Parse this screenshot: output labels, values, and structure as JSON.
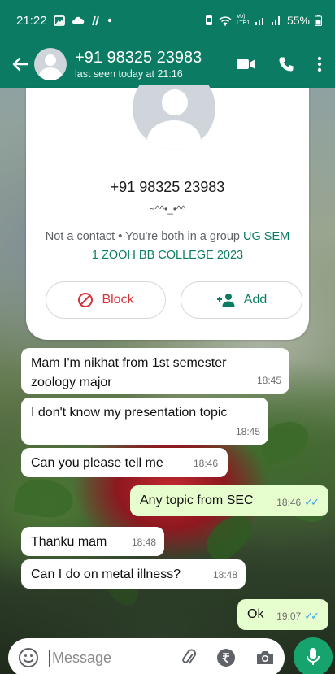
{
  "status_bar": {
    "time": "21:22",
    "battery": "55%",
    "network": "Vo) LTE1"
  },
  "app_bar": {
    "title": "+91 98325 23983",
    "subtitle": "last seen today at 21:16"
  },
  "contact_card": {
    "phone": "+91 98325 23983",
    "about": "~^^•_•^^",
    "group_prefix": "Not a contact • You're both in a group ",
    "group_name": "UG SEM 1 ZOOH BB COLLEGE 2023",
    "block_label": "Block",
    "add_label": "Add"
  },
  "messages": [
    {
      "direction": "in",
      "text": "Mam I'm nikhat from 1st semester zoology major",
      "time": "18:45"
    },
    {
      "direction": "in",
      "text": "I don't know my presentation topic",
      "time": "18:45"
    },
    {
      "direction": "in",
      "text": "Can you please tell me",
      "time": "18:46"
    },
    {
      "direction": "out",
      "text": "Any topic from SEC",
      "time": "18:46",
      "read": true
    },
    {
      "direction": "in",
      "text": "Thanku mam",
      "time": "18:48"
    },
    {
      "direction": "in",
      "text": "Can I do on metal illness?",
      "time": "18:48"
    },
    {
      "direction": "out",
      "text": "Ok",
      "time": "19:07",
      "read": true
    }
  ],
  "input": {
    "placeholder": "Message"
  },
  "colors": {
    "header": "#0b7c63",
    "outgoing_bubble": "#e6fdcd",
    "incoming_bubble": "#ffffff",
    "block": "#d6333a",
    "mic": "#16a36e",
    "read_ticks": "#3aa6e8"
  },
  "icons": {
    "status": [
      "gallery-icon",
      "cloud-icon",
      "nfc-icon",
      "dot-icon",
      "vibrate-icon",
      "wifi-icon",
      "signal-icon",
      "battery-icon"
    ],
    "header": [
      "back-arrow-icon",
      "video-call-icon",
      "voice-call-icon",
      "more-options-icon"
    ],
    "input": [
      "emoji-icon",
      "attach-icon",
      "rupee-payment-icon",
      "camera-icon",
      "mic-icon"
    ]
  }
}
